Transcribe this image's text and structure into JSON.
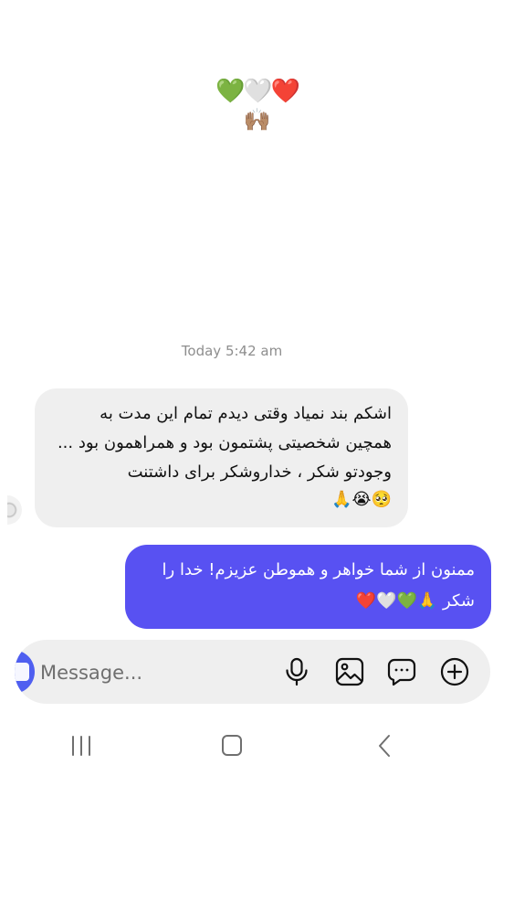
{
  "conversation": {
    "reaction_message": {
      "line1": "💚🤍❤️",
      "line2": "🙌🏽"
    },
    "timestamp": "Today 5:42 am",
    "incoming_message": {
      "text": "اشکم بند نمیاد وقتی دیدم تمام این مدت به همچین شخصیتی  پشتمون بود و همراهمون بود ... وجودتو شکر ، خداروشکر برای داشتنت",
      "emojis": "🥺😭🙏"
    },
    "outgoing_message": {
      "text": "ممنون از شما خواهر و هموطن عزیزم! خدا را شکر 🙏💚🤍❤️"
    }
  },
  "composer": {
    "placeholder": "Message...",
    "icons": [
      "camera-icon",
      "microphone-icon",
      "gallery-icon",
      "sticker-icon",
      "plus-icon"
    ]
  },
  "system_nav": {
    "icons": [
      "recent-apps-icon",
      "home-icon",
      "back-icon"
    ]
  },
  "colors": {
    "outgoing_bubble": "#5851f2",
    "incoming_bubble": "#efefef",
    "composer_background": "#efefef",
    "timestamp": "#8e8e8e",
    "camera_button": "#4f5ff0"
  }
}
